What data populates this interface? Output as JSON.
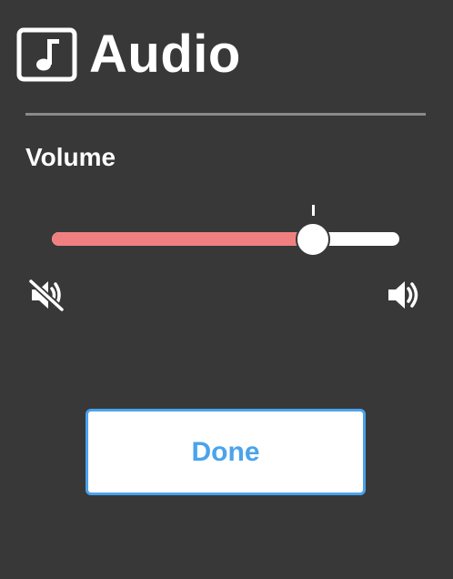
{
  "header": {
    "icon": "music-note-icon",
    "title": "Audio"
  },
  "volume": {
    "label": "Volume",
    "level_fraction": 0.75,
    "min_icon": "speaker-muted-icon",
    "max_icon": "speaker-loud-icon"
  },
  "actions": {
    "done_label": "Done"
  },
  "colors": {
    "background": "#383838",
    "slider_fill": "#f08080",
    "accent": "#4aa3ec",
    "divider": "#8a8a8a"
  }
}
